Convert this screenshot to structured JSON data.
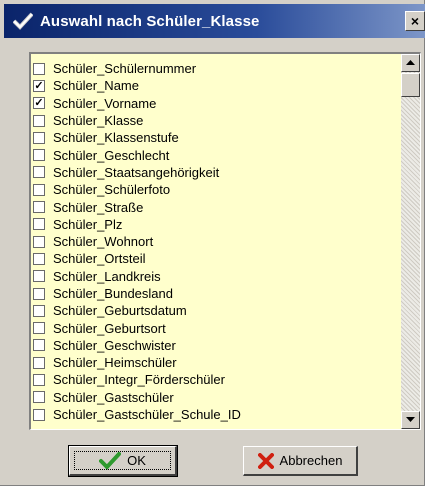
{
  "window": {
    "title": "Auswahl nach Schüler_Klasse",
    "title_icon": "check-icon",
    "close_symbol": "×"
  },
  "list": {
    "background": "#ffffcc",
    "items": [
      {
        "label": "Schüler_Schülernummer",
        "checked": false
      },
      {
        "label": "Schüler_Name",
        "checked": true
      },
      {
        "label": "Schüler_Vorname",
        "checked": true
      },
      {
        "label": "Schüler_Klasse",
        "checked": false
      },
      {
        "label": "Schüler_Klassenstufe",
        "checked": false
      },
      {
        "label": "Schüler_Geschlecht",
        "checked": false
      },
      {
        "label": "Schüler_Staatsangehörigkeit",
        "checked": false
      },
      {
        "label": "Schüler_Schülerfoto",
        "checked": false
      },
      {
        "label": "Schüler_Straße",
        "checked": false
      },
      {
        "label": "Schüler_Plz",
        "checked": false
      },
      {
        "label": "Schüler_Wohnort",
        "checked": false
      },
      {
        "label": "Schüler_Ortsteil",
        "checked": false
      },
      {
        "label": "Schüler_Landkreis",
        "checked": false
      },
      {
        "label": "Schüler_Bundesland",
        "checked": false
      },
      {
        "label": "Schüler_Geburtsdatum",
        "checked": false
      },
      {
        "label": "Schüler_Geburtsort",
        "checked": false
      },
      {
        "label": "Schüler_Geschwister",
        "checked": false
      },
      {
        "label": "Schüler_Heimschüler",
        "checked": false
      },
      {
        "label": "Schüler_Integr_Förderschüler",
        "checked": false
      },
      {
        "label": "Schüler_Gastschüler",
        "checked": false
      },
      {
        "label": "Schüler_Gastschüler_Schule_ID",
        "checked": false
      }
    ]
  },
  "buttons": {
    "ok_label": "OK",
    "ok_icon": "checkmark-icon",
    "ok_icon_color": "#2e9a2e",
    "cancel_label": "Abbrechen",
    "cancel_icon": "x-icon",
    "cancel_icon_color": "#d02010"
  }
}
